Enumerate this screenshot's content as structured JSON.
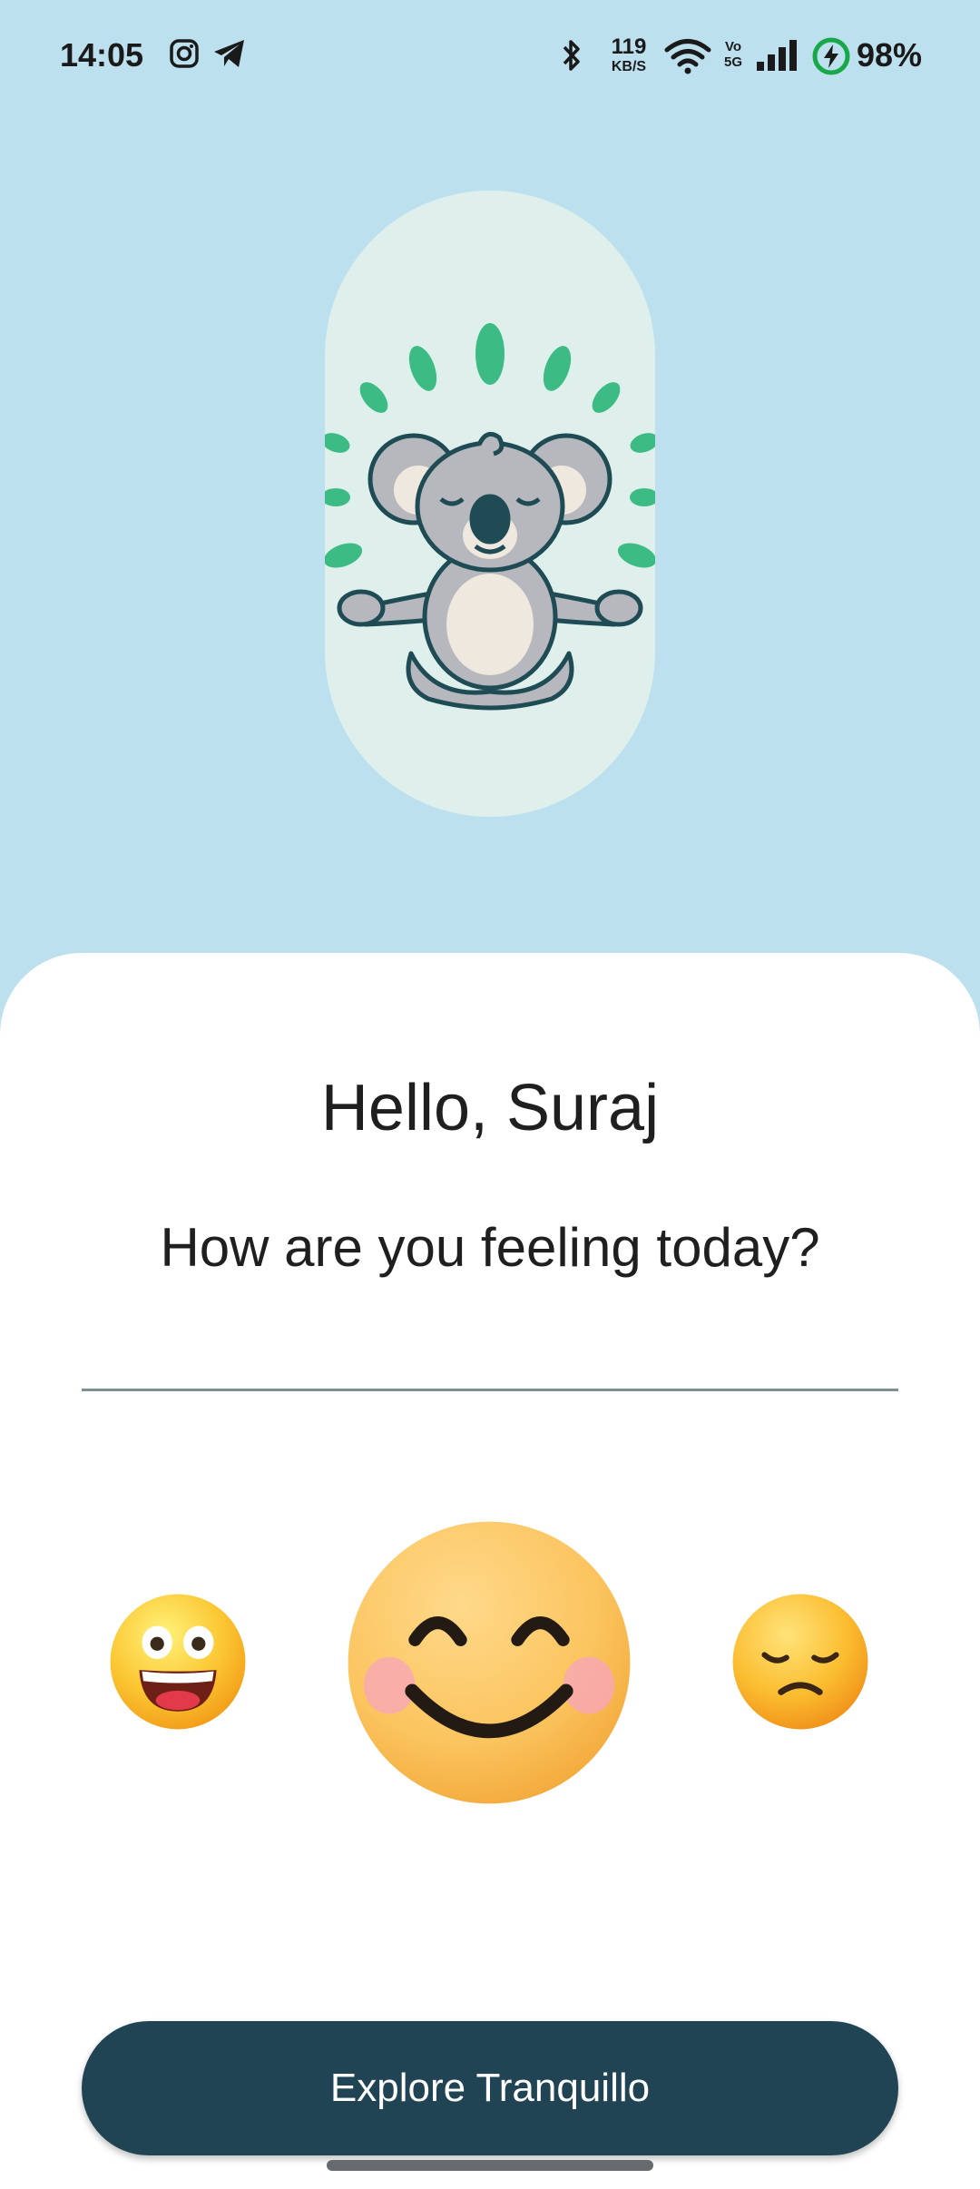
{
  "status_bar": {
    "time": "14:05",
    "net_speed_value": "119",
    "net_speed_unit": "KB/S",
    "volte_top": "Vo",
    "volte_bottom": "5G",
    "battery_percent": "98%",
    "icons": [
      "instagram-icon",
      "telegram-icon",
      "bluetooth-icon",
      "wifi-icon",
      "signal-icon",
      "battery-charging-icon"
    ]
  },
  "hero": {
    "illustration": "meditating-koala",
    "leaf_color": "#3dbb85",
    "capsule_color": "#dff0ec"
  },
  "greeting": "Hello, Suraj",
  "question": "How are you feeling today?",
  "moods": [
    {
      "name": "grinning-face",
      "selected": false
    },
    {
      "name": "smiling-face-with-smiling-eyes",
      "selected": true
    },
    {
      "name": "pensive-face",
      "selected": false
    }
  ],
  "cta": {
    "label": "Explore Tranquillo",
    "color": "#214454"
  },
  "colors": {
    "background": "#bde0ef",
    "card": "#ffffff"
  }
}
